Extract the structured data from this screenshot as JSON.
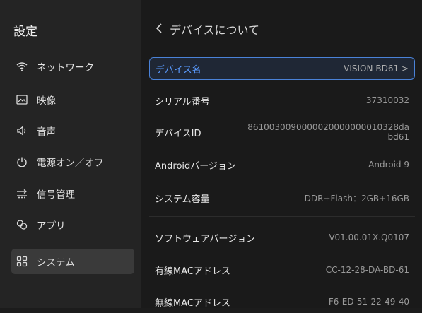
{
  "sidebar": {
    "title": "設定",
    "items": [
      {
        "label": "ネットワーク",
        "icon": "wifi-icon"
      },
      {
        "label": "映像",
        "icon": "image-icon"
      },
      {
        "label": "音声",
        "icon": "speaker-icon"
      },
      {
        "label": "電源オン／オフ",
        "icon": "power-icon"
      },
      {
        "label": "信号管理",
        "icon": "signal-input-icon"
      },
      {
        "label": "アプリ",
        "icon": "apps-icon"
      },
      {
        "label": "システム",
        "icon": "system-grid-icon",
        "active": true
      }
    ]
  },
  "header": {
    "back_label": "デバイスについて"
  },
  "rows": {
    "device_name": {
      "label": "デバイス名",
      "value": "VISION-BD61 >"
    },
    "serial": {
      "label": "シリアル番号",
      "value": "37310032"
    },
    "device_id": {
      "label": "デバイスID",
      "value": "8610030090000020000000010328dabd61"
    },
    "android": {
      "label": "Androidバージョン",
      "value": "Android 9"
    },
    "storage": {
      "label": "システム容量",
      "value": "DDR+Flash：2GB+16GB"
    },
    "software": {
      "label": "ソフトウェアバージョン",
      "value": "V01.00.01X.Q0107"
    },
    "wired_mac": {
      "label": "有線MACアドレス",
      "value": "CC-12-28-DA-BD-61"
    },
    "wireless_mac": {
      "label": "無線MACアドレス",
      "value": "F6-ED-51-22-49-40"
    }
  },
  "colors": {
    "accent": "#4a82d8",
    "background": "#1a1a1a",
    "sidebar": "#242424"
  }
}
